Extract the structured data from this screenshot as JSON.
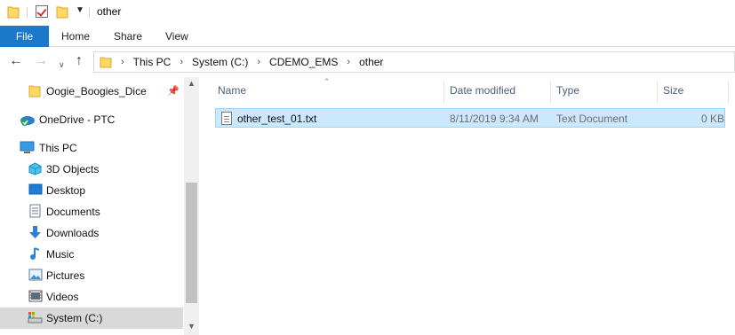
{
  "window": {
    "title": "other"
  },
  "ribbon": {
    "file_label": "File",
    "tabs": [
      "Home",
      "Share",
      "View"
    ]
  },
  "address": {
    "breadcrumbs": [
      "This PC",
      "System (C:)",
      "CDEMO_EMS",
      "other"
    ]
  },
  "sidebar": {
    "items": [
      {
        "label": "Oogie_Boogies_Dice",
        "icon": "folder-icon",
        "pinned": true
      },
      {
        "label": "OneDrive - PTC",
        "icon": "onedrive-cloud-icon"
      },
      {
        "label": "This PC",
        "icon": "computer-icon"
      },
      {
        "label": "3D Objects",
        "icon": "cube-icon"
      },
      {
        "label": "Desktop",
        "icon": "desktop-icon"
      },
      {
        "label": "Documents",
        "icon": "documents-icon"
      },
      {
        "label": "Downloads",
        "icon": "download-arrow-icon"
      },
      {
        "label": "Music",
        "icon": "music-note-icon"
      },
      {
        "label": "Pictures",
        "icon": "pictures-icon"
      },
      {
        "label": "Videos",
        "icon": "videos-icon"
      },
      {
        "label": "System (C:)",
        "icon": "drive-icon",
        "selected": true
      }
    ]
  },
  "columns": [
    "Name",
    "Date modified",
    "Type",
    "Size"
  ],
  "files": [
    {
      "name": "other_test_01.txt",
      "date_modified": "8/11/2019 9:34 AM",
      "type": "Text Document",
      "size": "0 KB",
      "selected": true
    }
  ],
  "colors": {
    "accent": "#1979ca",
    "selection_bg": "#cce8ff",
    "selection_border": "#99d1ff",
    "folder_yellow": "#ffd766"
  }
}
